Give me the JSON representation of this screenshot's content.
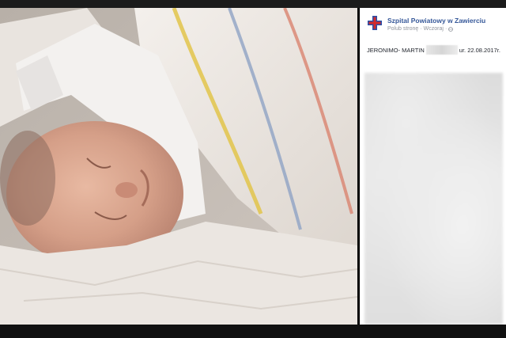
{
  "post": {
    "page_name": "Szpital Powiatowy w Zawierciu",
    "like_link": "Polub stronę",
    "separator": "·",
    "time": "Wczoraj",
    "time_separator": "·",
    "name_text": "JERONIMO- MARTIN",
    "date_text": "ur. 22.08.2017r."
  },
  "icons": {
    "logo": "hospital-cross-logo",
    "privacy": "globe-icon"
  },
  "colors": {
    "link": "#365899",
    "meta": "#90949c",
    "logo_red": "#d42a2a",
    "logo_blue": "#2a4fa8"
  }
}
